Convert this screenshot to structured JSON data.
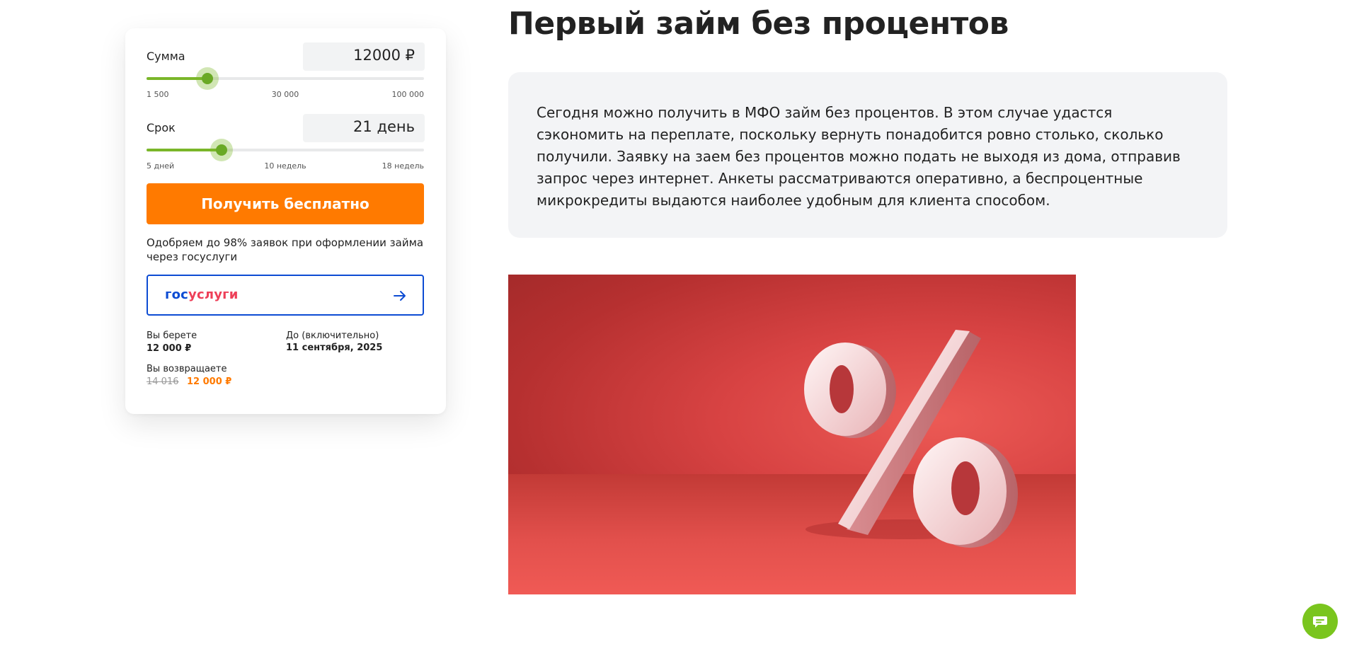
{
  "calculator": {
    "amount": {
      "label": "Сумма",
      "value": "12000 ₽",
      "slider_fraction": 0.22,
      "ticks": {
        "min": "1 500",
        "mid": "30 000",
        "max": "100 000"
      }
    },
    "term": {
      "label": "Срок",
      "value": "21 день",
      "slider_fraction": 0.27,
      "ticks": {
        "min": "5 дней",
        "mid": "10 недель",
        "max": "18 недель"
      }
    },
    "cta_label": "Получить бесплатно",
    "approve_text": "Одобряем до 98% заявок при оформлении займа через госуслуги",
    "gosuslugi": {
      "logo_part1": "гос",
      "logo_part2": "услуги",
      "brand_blue": "#0d4cd3",
      "brand_red": "#ee3f58"
    },
    "summary": {
      "take_label": "Вы берете",
      "take_value": "12 000 ₽",
      "until_label": "До (включительно)",
      "until_value": "11 сентября, 2025",
      "return_label": "Вы возвращаете",
      "return_old": "14 016",
      "return_new": "12 000 ₽"
    }
  },
  "article": {
    "title": "Первый займ без процентов",
    "paragraph": "Сегодня можно получить в МФО займ без процентов. В этом случае удастся сэкономить на переплате, поскольку вернуть понадобится ровно столько, сколько получили. Заявку на заем без процентов можно подать не выходя из дома, отправив запрос через интернет. Анкеты рассматриваются оперативно, а беспроцентные микрокредиты выдаются наиболее удобным для клиента способом.",
    "image_icon": "percent-sign-3d"
  },
  "colors": {
    "accent_orange": "#ff7a00",
    "accent_green": "#7ab629",
    "chat_green": "#7ac51e"
  },
  "chat_icon": "chat-bubble-icon"
}
